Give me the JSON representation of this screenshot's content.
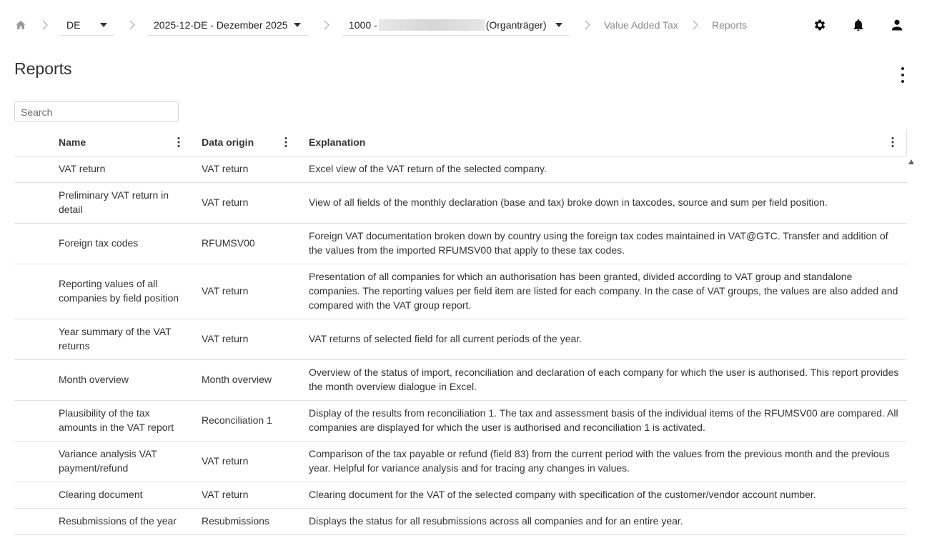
{
  "breadcrumb": {
    "country": "DE",
    "period": "2025-12-DE - Dezember 2025",
    "company_prefix": "1000 -",
    "company_suffix": "(Organträger)",
    "module": "Value Added Tax",
    "current": "Reports"
  },
  "page": {
    "title": "Reports"
  },
  "search": {
    "placeholder": "Search"
  },
  "table": {
    "columns": [
      "Name",
      "Data origin",
      "Explanation"
    ],
    "rows": [
      {
        "name": "VAT return",
        "origin": "VAT return",
        "explanation": "Excel view of the VAT return of the selected company."
      },
      {
        "name": "Preliminary VAT return in detail",
        "origin": "VAT return",
        "explanation": "View of all fields of the monthly declaration (base and tax) broke down in taxcodes, source and sum per field position."
      },
      {
        "name": "Foreign tax codes",
        "origin": "RFUMSV00",
        "explanation": "Foreign VAT documentation broken down by country using the foreign tax codes maintained in VAT@GTC. Transfer and addition of the values from the imported RFUMSV00 that apply to these tax codes."
      },
      {
        "name": "Reporting values of all companies by field position",
        "origin": "VAT return",
        "explanation": "Presentation of all companies for which an authorisation has been granted, divided according to VAT group and standalone companies. The reporting values per field item are listed for each company. In the case of VAT groups, the values are also added and compared with the VAT group report."
      },
      {
        "name": "Year summary of the VAT returns",
        "origin": "VAT return",
        "explanation": "VAT returns of selected field for all current periods of the year."
      },
      {
        "name": "Month overview",
        "origin": "Month overview",
        "explanation": "Overview of the status of import, reconciliation and declaration of each company for which the user is authorised. This report provides the month overview dialogue in Excel."
      },
      {
        "name": "Plausibility of the tax amounts in the VAT report",
        "origin": "Reconciliation 1",
        "explanation": "Display of the results from reconciliation 1. The tax and assessment basis of the individual items of the RFUMSV00 are compared. All companies are displayed for which the user is authorised and reconciliation 1 is activated."
      },
      {
        "name": "Variance analysis VAT payment/refund",
        "origin": "VAT return",
        "explanation": "Comparison of the tax payable or refund (field 83) from the current period with the values from the previous month and the previous year. Helpful for variance analysis and for tracing any changes in values."
      },
      {
        "name": "Clearing document",
        "origin": "VAT return",
        "explanation": "Clearing document for the VAT of the selected company with specification of the customer/vendor account number."
      },
      {
        "name": "Resubmissions of the year",
        "origin": "Resubmissions",
        "explanation": "Displays the status for all resubmissions across all companies and for an entire year."
      }
    ]
  }
}
